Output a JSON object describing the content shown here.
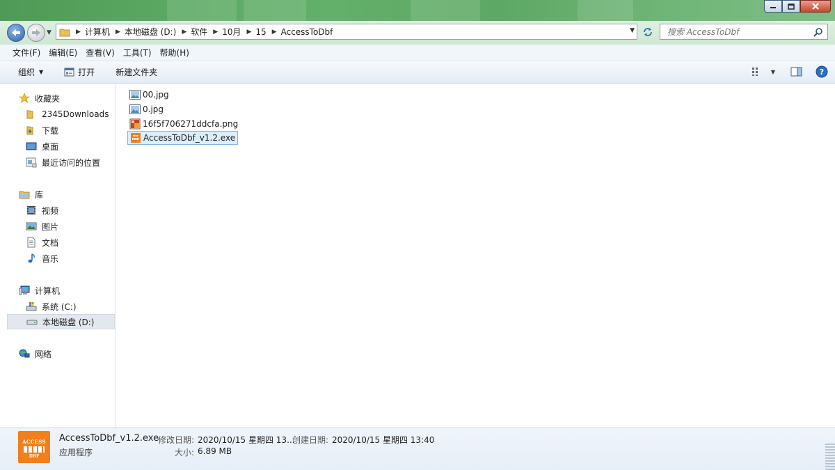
{
  "window": {
    "controls": {
      "minimize_icon": "minimize-icon",
      "maximize_icon": "maximize-icon",
      "close_icon": "close-icon"
    }
  },
  "address": {
    "crumbs": [
      "计算机",
      "本地磁盘 (D:)",
      "软件",
      "10月",
      "15",
      "AccessToDbf"
    ]
  },
  "search": {
    "placeholder": "搜索 AccessToDbf"
  },
  "menu": {
    "items": [
      "文件(F)",
      "编辑(E)",
      "查看(V)",
      "工具(T)",
      "帮助(H)"
    ]
  },
  "commands": {
    "organize": "组织",
    "open": "打开",
    "new_folder": "新建文件夹"
  },
  "nav": {
    "favorites": {
      "label": "收藏夹",
      "items": [
        "2345Downloads",
        "下载",
        "桌面",
        "最近访问的位置"
      ]
    },
    "libraries": {
      "label": "库",
      "items": [
        "视频",
        "图片",
        "文档",
        "音乐"
      ]
    },
    "computer": {
      "label": "计算机",
      "items": [
        "系统 (C:)",
        "本地磁盘 (D:)"
      ]
    },
    "network": {
      "label": "网络"
    }
  },
  "files": [
    {
      "name": "00.jpg",
      "type": "image"
    },
    {
      "name": "0.jpg",
      "type": "image"
    },
    {
      "name": "16f5f706271ddcfa.png",
      "type": "png"
    },
    {
      "name": "AccessToDbf_v1.2.exe",
      "type": "exe",
      "selected": true
    }
  ],
  "details": {
    "name": "AccessToDbf_v1.2.exe",
    "type": "应用程序",
    "icon_text_top": "ACCESS",
    "icon_text_bottom": "DBF",
    "modified_label": "修改日期:",
    "modified_value": "2020/10/15 星期四 13...",
    "created_label": "创建日期:",
    "created_value": "2020/10/15 星期四 13:40",
    "size_label": "大小:",
    "size_value": "6.89 MB"
  },
  "colors": {
    "titlebar": "#5aa862",
    "selection_bg": "#dbeefc",
    "selection_border": "#84b7e6",
    "exe_icon": "#f07f1c"
  }
}
